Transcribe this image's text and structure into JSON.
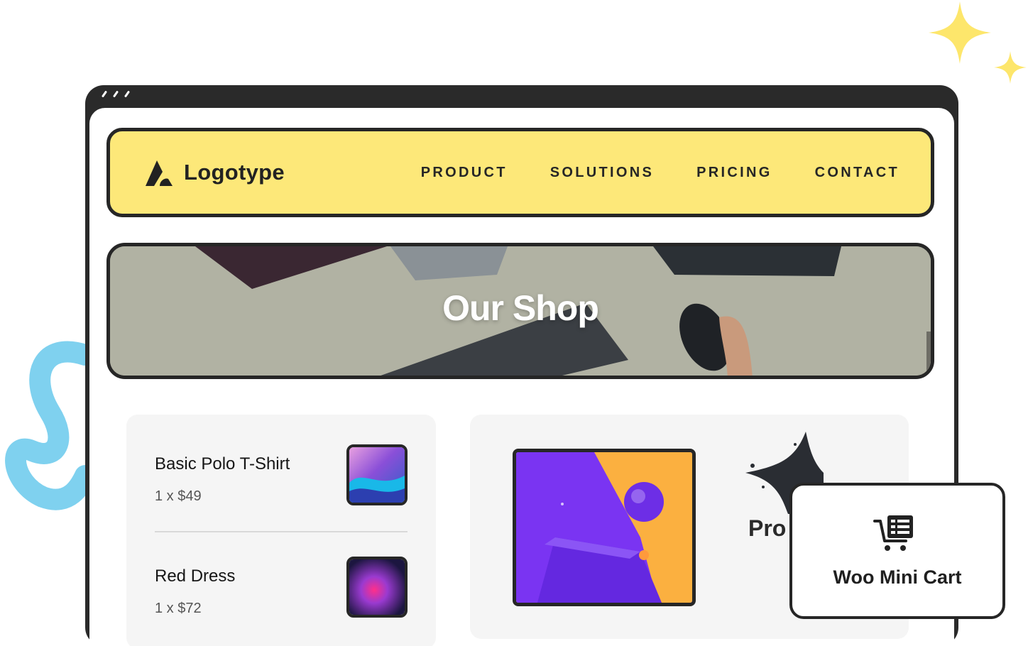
{
  "header": {
    "logo_text": "Logotype",
    "nav": [
      "PRODUCT",
      "SOLUTIONS",
      "PRICING",
      "CONTACT"
    ]
  },
  "banner": {
    "title": "Our Shop"
  },
  "cart": {
    "items": [
      {
        "name": "Basic Polo T-Shirt",
        "qty_price": "1 x $49"
      },
      {
        "name": "Red Dress",
        "qty_price": "1 x $72"
      }
    ]
  },
  "product": {
    "title_partial": "Pro"
  },
  "mini_cart": {
    "label": "Woo Mini Cart",
    "icon": "cart-list-icon"
  },
  "colors": {
    "header_bg": "#fde879",
    "frame": "#2a2a2a",
    "sparkle": "#fde66b",
    "squiggle": "#7fd1ef",
    "card_bg": "#f5f5f5"
  }
}
